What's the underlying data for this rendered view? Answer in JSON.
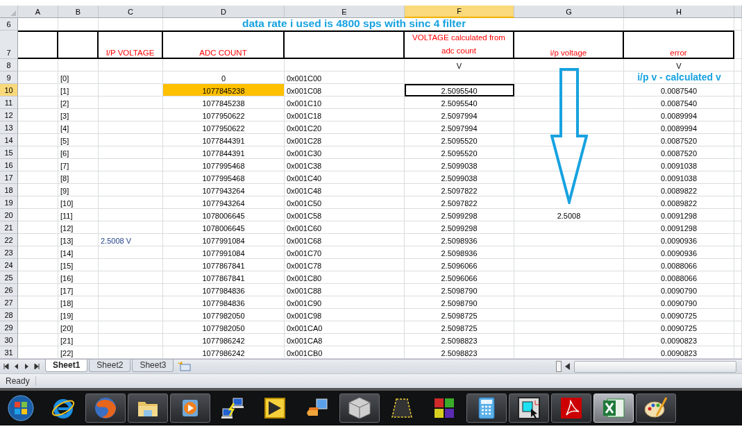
{
  "column_headers": [
    {
      "label": "A",
      "selected": false
    },
    {
      "label": "B",
      "selected": false
    },
    {
      "label": "C",
      "selected": false
    },
    {
      "label": "D",
      "selected": false
    },
    {
      "label": "E",
      "selected": false
    },
    {
      "label": "F",
      "selected": true
    },
    {
      "label": "G",
      "selected": false
    },
    {
      "label": "H",
      "selected": false
    }
  ],
  "title_row": {
    "number": "6",
    "text": "data rate i used is 4800 sps with sinc 4 filter"
  },
  "header_row": {
    "number": "7",
    "c": "I/P VOLTAGE",
    "d": "ADC COUNT",
    "f": "VOLTAGE calculated from adc count",
    "g": "i/p voltage",
    "h": "error"
  },
  "unit_row": {
    "number": "8",
    "f": "V",
    "h": "V"
  },
  "rows": [
    {
      "number": "9",
      "selected": false,
      "b": "[0]",
      "d": "0",
      "d_highlighted": false,
      "e": "0x001C00",
      "f_active": false,
      "note": "i/p v - calculated v"
    },
    {
      "number": "10",
      "selected": true,
      "b": "[1]",
      "d": "1077845238",
      "d_highlighted": true,
      "e": "0x001C08",
      "f": "2.5095540",
      "f_active": true,
      "h": "0.0087540"
    },
    {
      "number": "11",
      "selected": false,
      "b": "[2]",
      "d": "1077845238",
      "d_highlighted": false,
      "e": "0x001C10",
      "f": "2.5095540",
      "f_active": false,
      "h": "0.0087540"
    },
    {
      "number": "12",
      "selected": false,
      "b": "[3]",
      "d": "1077950622",
      "d_highlighted": false,
      "e": "0x001C18",
      "f": "2.5097994",
      "f_active": false,
      "h": "0.0089994"
    },
    {
      "number": "13",
      "selected": false,
      "b": "[4]",
      "d": "1077950622",
      "d_highlighted": false,
      "e": "0x001C20",
      "f": "2.5097994",
      "f_active": false,
      "h": "0.0089994"
    },
    {
      "number": "14",
      "selected": false,
      "b": "[5]",
      "d": "1077844391",
      "d_highlighted": false,
      "e": "0x001C28",
      "f": "2.5095520",
      "f_active": false,
      "h": "0.0087520"
    },
    {
      "number": "15",
      "selected": false,
      "b": "[6]",
      "d": "1077844391",
      "d_highlighted": false,
      "e": "0x001C30",
      "f": "2.5095520",
      "f_active": false,
      "h": "0.0087520"
    },
    {
      "number": "16",
      "selected": false,
      "b": "[7]",
      "d": "1077995468",
      "d_highlighted": false,
      "e": "0x001C38",
      "f": "2.5099038",
      "f_active": false,
      "h": "0.0091038"
    },
    {
      "number": "17",
      "selected": false,
      "b": "[8]",
      "d": "1077995468",
      "d_highlighted": false,
      "e": "0x001C40",
      "f": "2.5099038",
      "f_active": false,
      "h": "0.0091038"
    },
    {
      "number": "18",
      "selected": false,
      "b": "[9]",
      "d": "1077943264",
      "d_highlighted": false,
      "e": "0x001C48",
      "f": "2.5097822",
      "f_active": false,
      "h": "0.0089822"
    },
    {
      "number": "19",
      "selected": false,
      "b": "[10]",
      "d": "1077943264",
      "d_highlighted": false,
      "e": "0x001C50",
      "f": "2.5097822",
      "f_active": false,
      "h": "0.0089822"
    },
    {
      "number": "20",
      "selected": false,
      "b": "[11]",
      "d": "1078006645",
      "d_highlighted": false,
      "e": "0x001C58",
      "f": "2.5099298",
      "f_active": false,
      "g": "2.5008",
      "h": "0.0091298"
    },
    {
      "number": "21",
      "selected": false,
      "b": "[12]",
      "d": "1078006645",
      "d_highlighted": false,
      "e": "0x001C60",
      "f": "2.5099298",
      "f_active": false,
      "h": "0.0091298"
    },
    {
      "number": "22",
      "selected": false,
      "b": "[13]",
      "c": "2.5008 V",
      "d": "1077991084",
      "d_highlighted": false,
      "e": "0x001C68",
      "f": "2.5098936",
      "f_active": false,
      "h": "0.0090936"
    },
    {
      "number": "23",
      "selected": false,
      "b": "[14]",
      "d": "1077991084",
      "d_highlighted": false,
      "e": "0x001C70",
      "f": "2.5098936",
      "f_active": false,
      "h": "0.0090936"
    },
    {
      "number": "24",
      "selected": false,
      "b": "[15]",
      "d": "1077867841",
      "d_highlighted": false,
      "e": "0x001C78",
      "f": "2.5096066",
      "f_active": false,
      "h": "0.0088066"
    },
    {
      "number": "25",
      "selected": false,
      "b": "[16]",
      "d": "1077867841",
      "d_highlighted": false,
      "e": "0x001C80",
      "f": "2.5096066",
      "f_active": false,
      "h": "0.0088066"
    },
    {
      "number": "26",
      "selected": false,
      "b": "[17]",
      "d": "1077984836",
      "d_highlighted": false,
      "e": "0x001C88",
      "f": "2.5098790",
      "f_active": false,
      "h": "0.0090790"
    },
    {
      "number": "27",
      "selected": false,
      "b": "[18]",
      "d": "1077984836",
      "d_highlighted": false,
      "e": "0x001C90",
      "f": "2.5098790",
      "f_active": false,
      "h": "0.0090790"
    },
    {
      "number": "28",
      "selected": false,
      "b": "[19]",
      "d": "1077982050",
      "d_highlighted": false,
      "e": "0x001C98",
      "f": "2.5098725",
      "f_active": false,
      "h": "0.0090725"
    },
    {
      "number": "29",
      "selected": false,
      "b": "[20]",
      "d": "1077982050",
      "d_highlighted": false,
      "e": "0x001CA0",
      "f": "2.5098725",
      "f_active": false,
      "h": "0.0090725"
    },
    {
      "number": "30",
      "selected": false,
      "b": "[21]",
      "d": "1077986242",
      "d_highlighted": false,
      "e": "0x001CA8",
      "f": "2.5098823",
      "f_active": false,
      "h": "0.0090823"
    },
    {
      "number": "31",
      "selected": false,
      "b": "[22]",
      "d": "1077986242",
      "d_highlighted": false,
      "e": "0x001CB0",
      "f": "2.5098823",
      "f_active": false,
      "h": "0.0090823"
    }
  ],
  "sheet_tabs": [
    {
      "label": "Sheet1",
      "selected": true
    },
    {
      "label": "Sheet2",
      "selected": false
    },
    {
      "label": "Sheet3",
      "selected": false
    }
  ],
  "status_bar": "Ready",
  "taskbar": [
    {
      "kind": "start",
      "running": false,
      "selected": false
    },
    {
      "kind": "ie",
      "running": false,
      "selected": false
    },
    {
      "kind": "firefox",
      "running": true,
      "selected": false
    },
    {
      "kind": "folder",
      "running": true,
      "selected": false
    },
    {
      "kind": "media",
      "running": true,
      "selected": false
    },
    {
      "kind": "network",
      "running": false,
      "selected": false
    },
    {
      "kind": "labview",
      "running": false,
      "selected": false
    },
    {
      "kind": "phone",
      "running": false,
      "selected": false
    },
    {
      "kind": "cube",
      "running": true,
      "selected": false
    },
    {
      "kind": "tape",
      "running": false,
      "selected": false
    },
    {
      "kind": "blocks",
      "running": false,
      "selected": false
    },
    {
      "kind": "calculator",
      "running": true,
      "selected": false
    },
    {
      "kind": "chip",
      "running": true,
      "selected": false
    },
    {
      "kind": "pdf",
      "running": true,
      "selected": false
    },
    {
      "kind": "excel",
      "running": true,
      "selected": true
    },
    {
      "kind": "paint",
      "running": true,
      "selected": false
    }
  ]
}
